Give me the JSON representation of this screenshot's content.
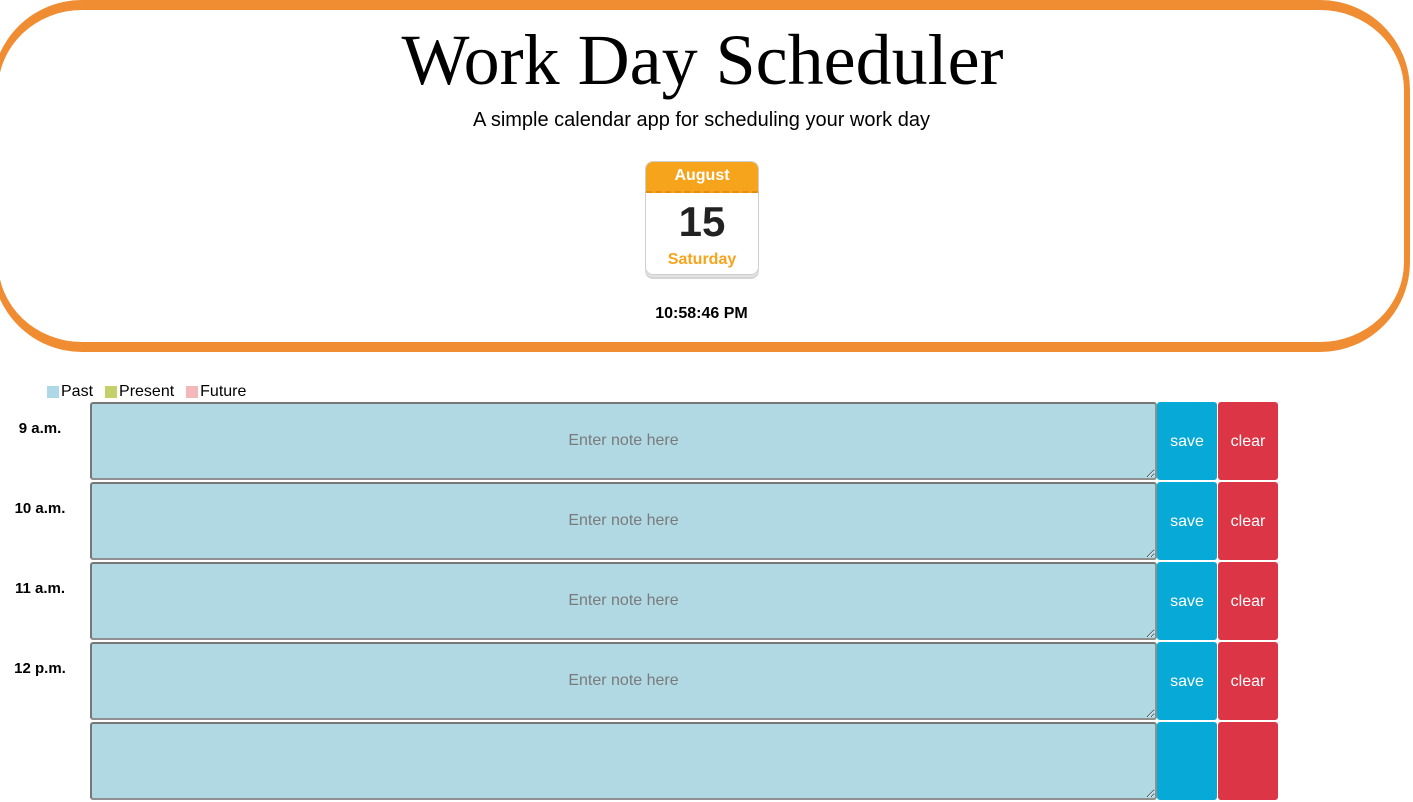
{
  "header": {
    "title": "Work Day Scheduler",
    "subtitle": "A simple calendar app for scheduling your work day",
    "accent_color": "#f08c32"
  },
  "calendar": {
    "month": "August",
    "day": "15",
    "weekday": "Saturday",
    "accent_color": "#f7a41d"
  },
  "clock": {
    "time": "10:58:46 PM"
  },
  "legend": {
    "items": [
      {
        "label": "Past",
        "color": "#add8e6"
      },
      {
        "label": "Present",
        "color": "#c5d06a"
      },
      {
        "label": "Future",
        "color": "#f4b8b8"
      }
    ]
  },
  "schedule": {
    "rows": [
      {
        "hour": "9 a.m.",
        "placeholder": "Enter note here",
        "save_label": "save",
        "clear_label": "clear"
      },
      {
        "hour": "10 a.m.",
        "placeholder": "Enter note here",
        "save_label": "save",
        "clear_label": "clear"
      },
      {
        "hour": "11 a.m.",
        "placeholder": "Enter note here",
        "save_label": "save",
        "clear_label": "clear"
      },
      {
        "hour": "12 p.m.",
        "placeholder": "Enter note here",
        "save_label": "save",
        "clear_label": "clear"
      },
      {
        "hour": "",
        "placeholder": "",
        "save_label": "",
        "clear_label": ""
      }
    ]
  }
}
